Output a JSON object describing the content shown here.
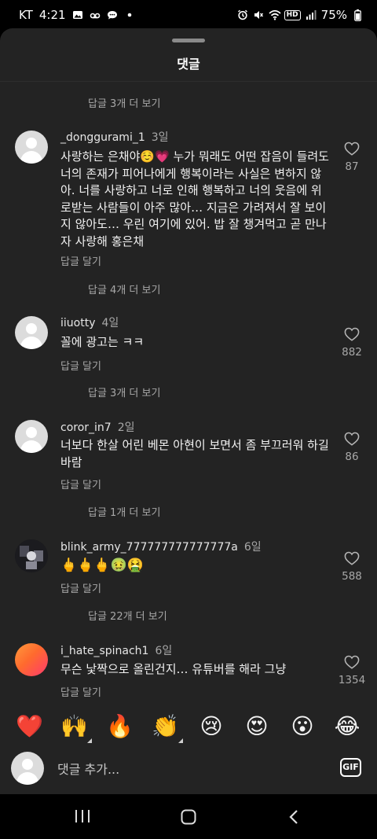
{
  "status": {
    "carrier": "KT",
    "time": "4:21",
    "network": "HD",
    "battery": "75%",
    "icons_left": [
      "gallery-icon",
      "voicemail-icon",
      "chat-icon",
      "dot-icon"
    ],
    "icons_right": [
      "alarm-icon",
      "mute-icon",
      "wifi-icon",
      "hd-icon",
      "signal-icon",
      "battery-icon"
    ]
  },
  "sheet": {
    "title": "댓글"
  },
  "comments": [
    {
      "user": "_donggurami_1",
      "age": "3일",
      "text": "사랑하는 은채야☺️💗 누가 뭐래도 어떤 잡음이 들려도 너의 존재가 피어나에게 행복이라는 사실은 변하지 않아. 너를 사랑하고 너로 인해 행복하고 너의 웃음에 위로받는 사람들이 아주 많아… 지금은 가려져서 잘 보이지 않아도… 우린 여기에 있어. 밥 잘 챙겨먹고 곧 만나자 사랑해 홍은채",
      "reply": "답글 달기",
      "likes": "87"
    },
    {
      "user": "iiuotty",
      "age": "4일",
      "text": "꼴에 광고는 ㅋㅋ",
      "reply": "답글 달기",
      "likes": "882"
    },
    {
      "user": "coror_in7",
      "age": "2일",
      "text": "너보다 한살 어린 베몬 아현이 보면서 좀 부끄러워 하길 바람",
      "reply": "답글 달기",
      "likes": "86"
    },
    {
      "user": "blink_army_777777777777777a",
      "age": "6일",
      "text": "🖕🖕🖕🤢🤮",
      "reply": "답글 달기",
      "likes": "588"
    },
    {
      "user": "i_hate_spinach1",
      "age": "6일",
      "text": "무슨 낯짝으로 올린건지… 유튜버를 해라 그냥",
      "reply": "답글 달기",
      "likes": "1354"
    }
  ],
  "more_replies": [
    "답글 3개 더 보기",
    "답글 4개 더 보기",
    "답글 3개 더 보기",
    "답글 1개 더 보기",
    "답글 22개 더 보기"
  ],
  "emojis": [
    {
      "glyph": "❤️",
      "name": "heart"
    },
    {
      "glyph": "🙌",
      "name": "raising-hands"
    },
    {
      "glyph": "🔥",
      "name": "fire"
    },
    {
      "glyph": "👏",
      "name": "clapping-hands"
    },
    {
      "glyph": "😢",
      "name": "crying-face"
    },
    {
      "glyph": "😍",
      "name": "heart-eyes"
    },
    {
      "glyph": "😮",
      "name": "surprised-face"
    },
    {
      "glyph": "😂",
      "name": "tears-of-joy"
    }
  ],
  "composer": {
    "placeholder": "댓글 추가...",
    "gif_label": "GIF"
  },
  "colors": {
    "background": "#000000",
    "sheet": "#232323",
    "text": "#f2f2f2",
    "muted": "#a8a8a8",
    "heart_red": "#ff3040"
  }
}
